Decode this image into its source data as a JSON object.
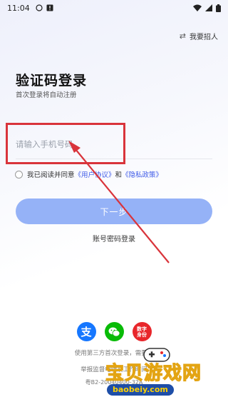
{
  "status_bar": {
    "time": "11:04",
    "icons_left": [
      "circle-outline-icon",
      "warning-icon"
    ],
    "icons_right": [
      "wifi-icon",
      "signal-icon",
      "battery-icon"
    ]
  },
  "header": {
    "recruit_label": "我要招人",
    "recruit_icon": "swap-icon"
  },
  "login": {
    "title": "验证码登录",
    "subtitle": "首次登录将自动注册",
    "phone_placeholder": "请输入手机号码",
    "phone_value": "",
    "agreement_prefix": "我已阅读并同意",
    "user_agreement": "《用户协议》",
    "and": "和",
    "privacy_policy": "《隐私政策》",
    "next_label": "下一步",
    "password_login": "账号密码登录"
  },
  "third_party": {
    "alipay_glyph": "支",
    "digital_id": "数字身份",
    "note": "使用第三方首次登录，需要验"
  },
  "footer": {
    "report": "举报监督电话及工作时间",
    "icp": "粤B2-20040400-32A"
  },
  "watermark": {
    "cn": "宝贝游戏网",
    "domain": "baobeiy.com"
  },
  "colors": {
    "accent": "#3f5be8",
    "button": "#95b2f7",
    "highlight": "#d9343b",
    "alipay": "#1677ff",
    "wechat": "#09bb07",
    "digital_id": "#e8262b"
  }
}
